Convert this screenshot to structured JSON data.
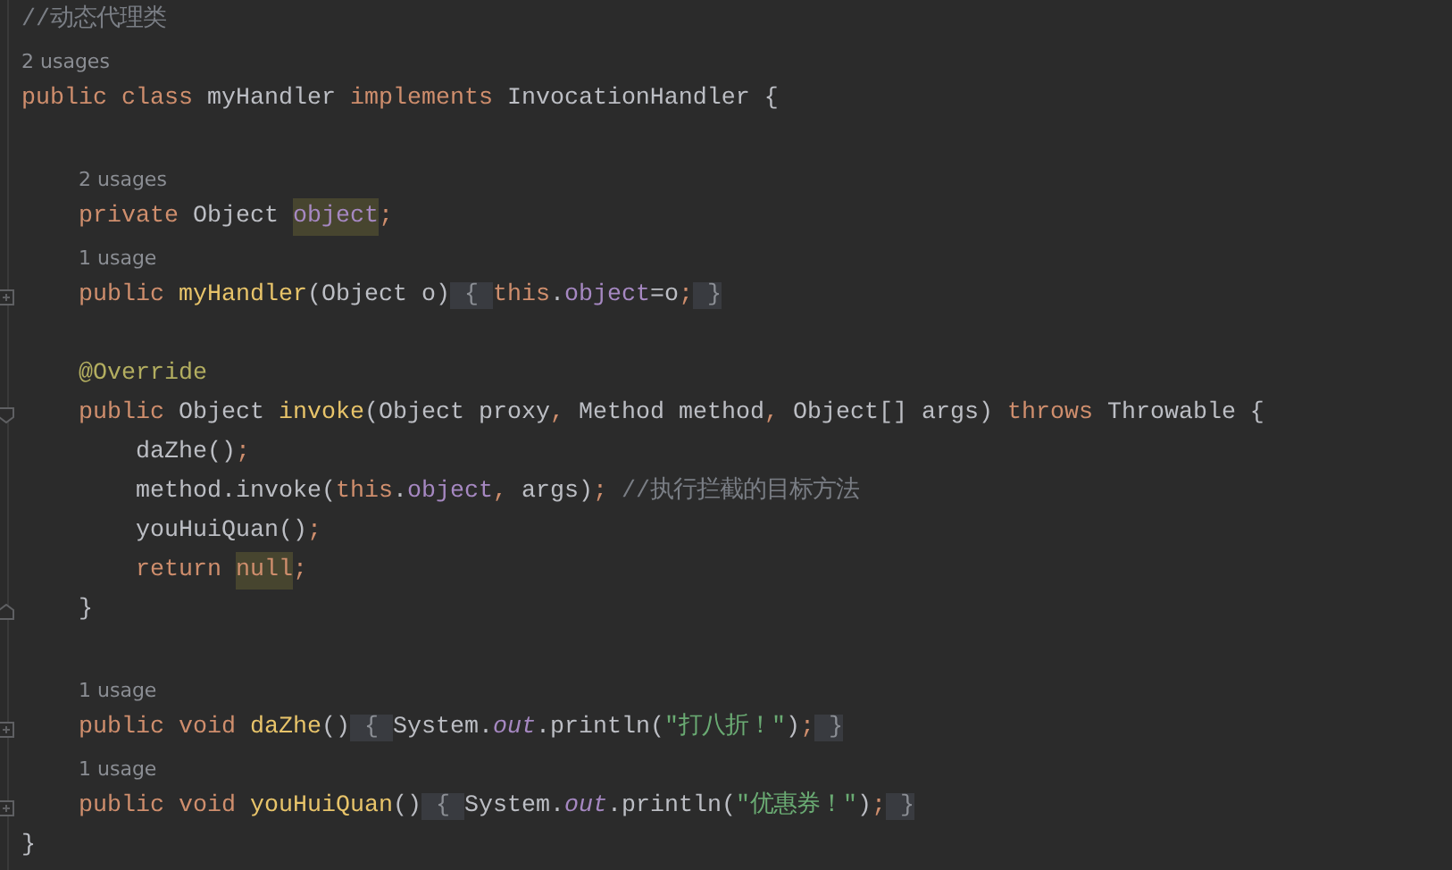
{
  "editor": {
    "lines": [
      {
        "kind": "code",
        "tokens": [
          {
            "text": "//动态代理类",
            "kind": "comment"
          }
        ]
      },
      {
        "kind": "usage",
        "text": "2 usages"
      },
      {
        "kind": "code",
        "tokens": [
          {
            "text": "public class ",
            "kind": "keyword"
          },
          {
            "text": "myHandler ",
            "kind": "plain"
          },
          {
            "text": "implements ",
            "kind": "keyword"
          },
          {
            "text": "InvocationHandler {",
            "kind": "plain"
          }
        ],
        "children": [
          {
            "kind": "blank"
          },
          {
            "kind": "usage",
            "text": "2 usages"
          },
          {
            "kind": "code",
            "tokens": [
              {
                "text": "private ",
                "kind": "keyword"
              },
              {
                "text": "Object ",
                "kind": "plain"
              },
              {
                "text": "object",
                "kind": "field-usage"
              },
              {
                "text": ";",
                "kind": "keyword"
              }
            ]
          },
          {
            "kind": "usage",
            "text": "1 usage"
          },
          {
            "kind": "code",
            "fold": {
              "kind": "start",
              "expanded": false
            },
            "tokens": [
              {
                "text": "public ",
                "kind": "keyword"
              },
              {
                "text": "myHandler",
                "kind": "method"
              },
              {
                "text": "(Object o)",
                "kind": "plain"
              },
              {
                "text": " { ",
                "kind": "folded"
              },
              {
                "text": "this",
                "kind": "keyword"
              },
              {
                "text": ".",
                "kind": "plain"
              },
              {
                "text": "object",
                "kind": "field"
              },
              {
                "text": "=o",
                "kind": "plain"
              },
              {
                "text": ";",
                "kind": "keyword"
              },
              {
                "text": " }",
                "kind": "folded"
              }
            ]
          },
          {
            "kind": "blank"
          },
          {
            "kind": "code",
            "tokens": [
              {
                "text": "@Override",
                "kind": "annotation"
              }
            ]
          },
          {
            "kind": "code",
            "fold": {
              "kind": "start",
              "expanded": true
            },
            "tokens": [
              {
                "text": "public ",
                "kind": "keyword"
              },
              {
                "text": "Object ",
                "kind": "plain"
              },
              {
                "text": "invoke",
                "kind": "method"
              },
              {
                "text": "(Object proxy",
                "kind": "plain"
              },
              {
                "text": ", ",
                "kind": "keyword"
              },
              {
                "text": "Method method",
                "kind": "plain"
              },
              {
                "text": ", ",
                "kind": "keyword"
              },
              {
                "text": "Object[] args) ",
                "kind": "plain"
              },
              {
                "text": "throws ",
                "kind": "keyword"
              },
              {
                "text": "Throwable {",
                "kind": "plain"
              }
            ],
            "children": [
              {
                "kind": "code",
                "tokens": [
                  {
                    "text": "daZhe()",
                    "kind": "plain"
                  },
                  {
                    "text": ";",
                    "kind": "keyword"
                  }
                ]
              },
              {
                "kind": "code",
                "tokens": [
                  {
                    "text": "method.invoke(",
                    "kind": "plain"
                  },
                  {
                    "text": "this",
                    "kind": "keyword"
                  },
                  {
                    "text": ".",
                    "kind": "plain"
                  },
                  {
                    "text": "object",
                    "kind": "field"
                  },
                  {
                    "text": ", ",
                    "kind": "keyword"
                  },
                  {
                    "text": "args)",
                    "kind": "plain"
                  },
                  {
                    "text": "; ",
                    "kind": "keyword"
                  },
                  {
                    "text": "//执行拦截的目标方法",
                    "kind": "comment"
                  }
                ]
              },
              {
                "kind": "code",
                "tokens": [
                  {
                    "text": "youHuiQuan()",
                    "kind": "plain"
                  },
                  {
                    "text": ";",
                    "kind": "keyword"
                  }
                ]
              },
              {
                "kind": "code",
                "tokens": [
                  {
                    "text": "return ",
                    "kind": "keyword"
                  },
                  {
                    "text": "null",
                    "kind": "keyword-usage"
                  },
                  {
                    "text": ";",
                    "kind": "keyword"
                  }
                ]
              }
            ]
          },
          {
            "kind": "code",
            "fold": {
              "kind": "end",
              "expanded": true
            },
            "tokens": [
              {
                "text": "}",
                "kind": "plain"
              }
            ]
          },
          {
            "kind": "blank"
          },
          {
            "kind": "usage",
            "text": "1 usage"
          },
          {
            "kind": "code",
            "fold": {
              "kind": "start",
              "expanded": false
            },
            "tokens": [
              {
                "text": "public void ",
                "kind": "keyword"
              },
              {
                "text": "daZhe",
                "kind": "method"
              },
              {
                "text": "()",
                "kind": "plain"
              },
              {
                "text": " { ",
                "kind": "folded"
              },
              {
                "text": "System.",
                "kind": "plain"
              },
              {
                "text": "out",
                "kind": "static"
              },
              {
                "text": ".println(",
                "kind": "plain"
              },
              {
                "text": "\"打八折！\"",
                "kind": "string"
              },
              {
                "text": ")",
                "kind": "plain"
              },
              {
                "text": ";",
                "kind": "keyword"
              },
              {
                "text": " }",
                "kind": "folded"
              }
            ]
          },
          {
            "kind": "usage",
            "text": "1 usage"
          },
          {
            "kind": "code",
            "fold": {
              "kind": "start",
              "expanded": false
            },
            "tokens": [
              {
                "text": "public void ",
                "kind": "keyword"
              },
              {
                "text": "youHuiQuan",
                "kind": "method"
              },
              {
                "text": "()",
                "kind": "plain"
              },
              {
                "text": " { ",
                "kind": "folded"
              },
              {
                "text": "System.",
                "kind": "plain"
              },
              {
                "text": "out",
                "kind": "static"
              },
              {
                "text": ".println(",
                "kind": "plain"
              },
              {
                "text": "\"优惠券！\"",
                "kind": "string"
              },
              {
                "text": ")",
                "kind": "plain"
              },
              {
                "text": ";",
                "kind": "keyword"
              },
              {
                "text": " }",
                "kind": "folded"
              }
            ]
          }
        ]
      },
      {
        "kind": "code",
        "tokens": [
          {
            "text": "}",
            "kind": "plain"
          }
        ]
      }
    ]
  }
}
